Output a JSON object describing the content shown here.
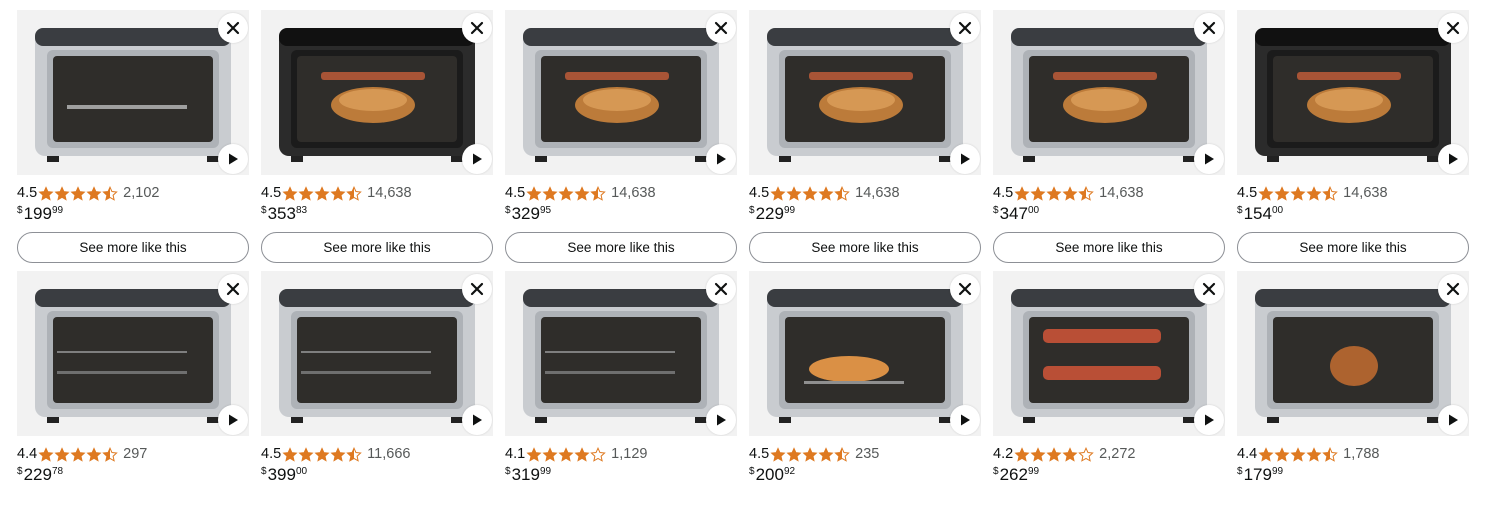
{
  "products_row1": [
    {
      "rating": "4.5",
      "stars": 4.5,
      "count": "2,102",
      "currency": "$",
      "price_whole": "199",
      "price_fraction": "99",
      "see_more": "See more like this",
      "image": "ninja-double-oven-image"
    },
    {
      "rating": "4.5",
      "stars": 4.5,
      "count": "14,638",
      "currency": "$",
      "price_whole": "353",
      "price_fraction": "83",
      "see_more": "See more like this",
      "image": "black-countertop-oven-chicken-image"
    },
    {
      "rating": "4.5",
      "stars": 4.5,
      "count": "14,638",
      "currency": "$",
      "price_whole": "329",
      "price_fraction": "95",
      "see_more": "See more like this",
      "image": "steel-countertop-oven-chicken-image"
    },
    {
      "rating": "4.5",
      "stars": 4.5,
      "count": "14,638",
      "currency": "$",
      "price_whole": "229",
      "price_fraction": "99",
      "see_more": "See more like this",
      "image": "silver-countertop-oven-image"
    },
    {
      "rating": "4.5",
      "stars": 4.5,
      "count": "14,638",
      "currency": "$",
      "price_whole": "347",
      "price_fraction": "00",
      "see_more": "See more like this",
      "image": "steel-oven-roast-chicken-image"
    },
    {
      "rating": "4.5",
      "stars": 4.5,
      "count": "14,638",
      "currency": "$",
      "price_whole": "154",
      "price_fraction": "00",
      "see_more": "See more like this",
      "image": "dark-top-oven-chicken-image"
    }
  ],
  "products_row2": [
    {
      "rating": "4.4",
      "stars": 4.5,
      "count": "297",
      "currency": "$",
      "price_whole": "229",
      "price_fraction": "78",
      "image": "breville-toaster-oven-image"
    },
    {
      "rating": "4.5",
      "stars": 4.5,
      "count": "11,666",
      "currency": "$",
      "price_whole": "399",
      "price_fraction": "00",
      "image": "breville-smart-oven-image"
    },
    {
      "rating": "4.1",
      "stars": 4,
      "count": "1,129",
      "currency": "$",
      "price_whole": "319",
      "price_fraction": "99",
      "image": "delonghi-oven-image"
    },
    {
      "rating": "4.5",
      "stars": 4.5,
      "count": "235",
      "currency": "$",
      "price_whole": "200",
      "price_fraction": "92",
      "image": "hamilton-beach-oven-image"
    },
    {
      "rating": "4.2",
      "stars": 4,
      "count": "2,272",
      "currency": "$",
      "price_whole": "262",
      "price_fraction": "99",
      "image": "oster-french-door-oven-image"
    },
    {
      "rating": "4.4",
      "stars": 4.5,
      "count": "1,788",
      "currency": "$",
      "price_whole": "179",
      "price_fraction": "99",
      "image": "dash-air-fryer-oven-image"
    }
  ],
  "colors": {
    "star": "#de7921",
    "text": "#0f1111",
    "muted": "#565959",
    "image_bg": "#f2f2f2",
    "button_border": "#8d9096"
  },
  "icons": {
    "close": "close-icon",
    "play": "play-icon",
    "star_full": "star-full-icon",
    "star_half": "star-half-icon",
    "star_empty": "star-empty-icon"
  }
}
